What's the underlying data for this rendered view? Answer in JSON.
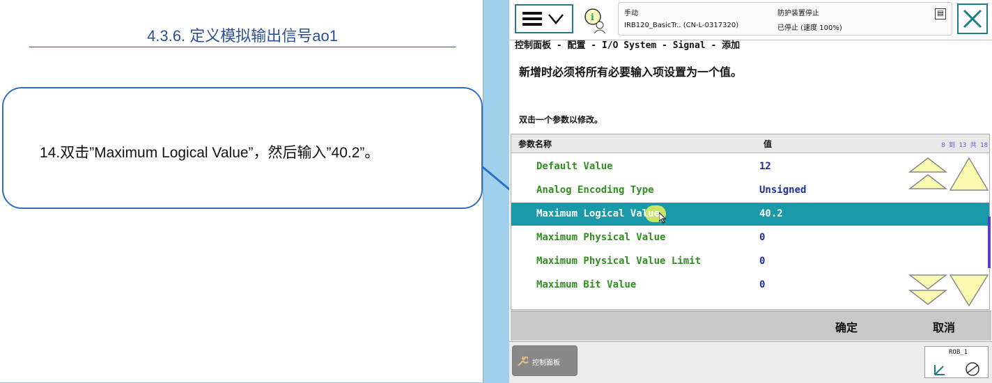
{
  "slide": {
    "title": "4.3.6. 定义模拟输出信号ao1",
    "instruction": "14.双击”Maximum Logical Value”，然后输入”40.2”。"
  },
  "flexpendant": {
    "status": {
      "mode": "手动",
      "controller": "IRB120_BasicTr.. (CN-L-0317320)",
      "safety": "防护装置停止",
      "state": "已停止 (速度 100%)"
    },
    "breadcrumb": "控制面板 - 配置 - I/O System - Signal - 添加",
    "message": "新增时必须将所有必要输入项设置为一个值。",
    "hint": "双击一个参数以修改。",
    "table": {
      "col_name": "参数名称",
      "col_value": "值",
      "range": "8 到 13 共 18",
      "rows": [
        {
          "name": "Default Value",
          "value": "12"
        },
        {
          "name": "Analog Encoding Type",
          "value": "Unsigned"
        },
        {
          "name": "Maximum Logical Value",
          "value": "40.2"
        },
        {
          "name": "Maximum Physical Value",
          "value": "0"
        },
        {
          "name": "Maximum Physical Value Limit",
          "value": "0"
        },
        {
          "name": "Maximum Bit Value",
          "value": "0"
        }
      ],
      "selected_index": 2
    },
    "buttons": {
      "ok": "确定",
      "cancel": "取消"
    },
    "taskbar": {
      "control_panel": "控制面板",
      "robot": "ROB_1"
    },
    "colors": {
      "accent": "#1a9aa8",
      "name_text": "#2f8f1f",
      "value_text": "#1e2f9e"
    }
  }
}
